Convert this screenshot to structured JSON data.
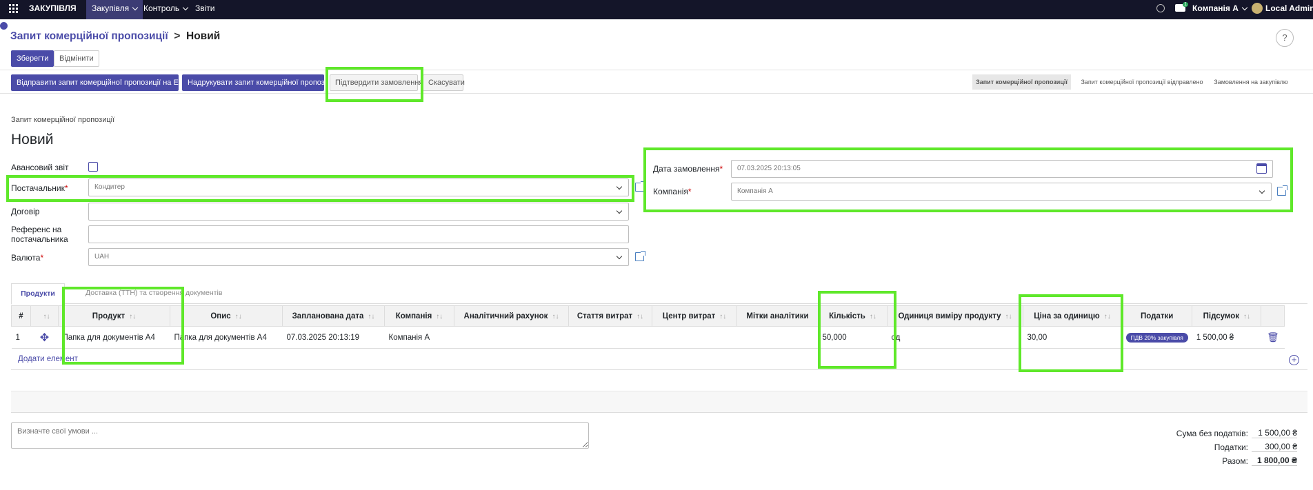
{
  "topbar": {
    "app_name": "ЗАКУПІВЛЯ",
    "menus": [
      "Закупівля",
      "Контроль",
      "Звіти"
    ],
    "company": "Компанія А",
    "user": "Local Admin",
    "messages_count": "1"
  },
  "page": {
    "breadcrumb_parent": "Запит комерційної пропозиції",
    "breadcrumb_current": "Новий",
    "help": "?"
  },
  "actions": {
    "save": "Зберегти",
    "discard": "Відмінити",
    "send_email": "Відправити запит комерційної пропозиції на Email",
    "print": "Надрукувати запит комерційної пропозиції",
    "confirm": "Підтвердити замовлення",
    "cancel": "Скасувати"
  },
  "statusbar": [
    "Запит комерційної пропозиції",
    "Запит комерційної пропозиції відправлено",
    "Замовлення на закупівлю"
  ],
  "form": {
    "doc_type": "Запит комерційної пропозиції",
    "title": "Новий",
    "advance_label": "Авансовий звіт",
    "vendor_label": "Постачальник",
    "vendor_value": "Кондитер",
    "contract_label": "Договір",
    "vendor_ref_label": "Референс на постачальника",
    "currency_label": "Валюта",
    "currency_value": "UAH",
    "order_date_label": "Дата замовлення",
    "order_date_value": "07.03.2025 20:13:05",
    "company_label": "Компанія",
    "company_value": "Компанія А"
  },
  "tabs": [
    "Продукти",
    "Доставка (ТТН) та створення документів"
  ],
  "table": {
    "columns": [
      "#",
      "",
      "Продукт",
      "Опис",
      "Запланована дата",
      "Компанія",
      "Аналітичний рахунок",
      "Стаття витрат",
      "Центр витрат",
      "Мітки аналітики",
      "Кількість",
      "Одиниця виміру продукту",
      "Ціна за одиницю",
      "Податки",
      "Підсумок"
    ],
    "rows": [
      {
        "num": "1",
        "product": "Папка для документів А4",
        "description": "Папка для документів А4",
        "date": "07.03.2025 20:13:19",
        "company": "Компанія А",
        "quantity": "50,000",
        "uom": "од",
        "price": "30,00",
        "tax": "ПДВ 20% закупівля",
        "subtotal": "1 500,00 ₴"
      }
    ],
    "add_line": "Додати елемент"
  },
  "notes_placeholder": "Визначте свої умови ...",
  "totals": {
    "untaxed_label": "Сума без податків:",
    "untaxed_value": "1 500,00 ₴",
    "taxes_label": "Податки:",
    "taxes_value": "300,00 ₴",
    "total_label": "Разом:",
    "total_value": "1 800,00 ₴"
  },
  "colors": {
    "primary": "#4a4ba8",
    "highlight": "#5fe82a",
    "topbar": "#141529"
  }
}
